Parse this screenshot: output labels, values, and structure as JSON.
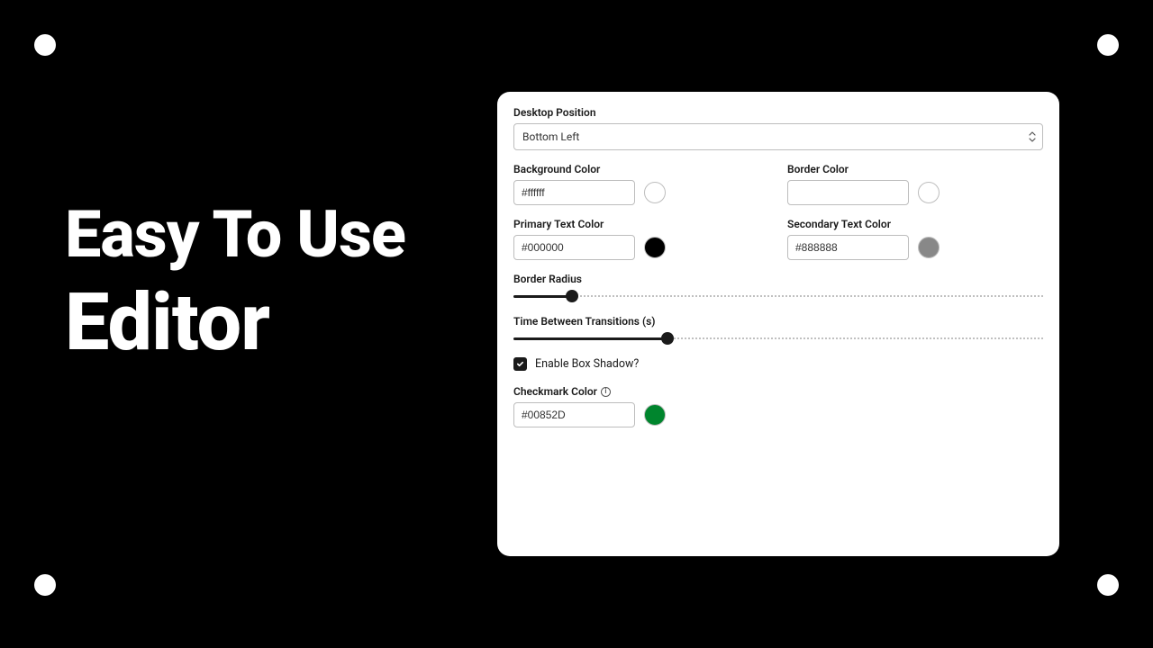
{
  "headline": {
    "line1": "Easy To Use",
    "line2": "Editor"
  },
  "panel": {
    "desktopPosition": {
      "label": "Desktop Position",
      "value": "Bottom Left"
    },
    "backgroundColor": {
      "label": "Background Color",
      "value": "#ffffff",
      "swatch": "#ffffff"
    },
    "borderColor": {
      "label": "Border Color",
      "value": "",
      "swatch": "#ffffff"
    },
    "primaryText": {
      "label": "Primary Text Color",
      "value": "#000000",
      "swatch": "#000000"
    },
    "secondaryText": {
      "label": "Secondary Text Color",
      "value": "#888888",
      "swatch": "#888888"
    },
    "borderRadius": {
      "label": "Border Radius",
      "percent": 11
    },
    "timeBetween": {
      "label": "Time Between Transitions (s)",
      "percent": 29
    },
    "enableShadow": {
      "label": "Enable Box Shadow?",
      "checked": true
    },
    "checkmarkColor": {
      "label": "Checkmark Color",
      "value": "#00852D",
      "swatch": "#00852D"
    }
  }
}
